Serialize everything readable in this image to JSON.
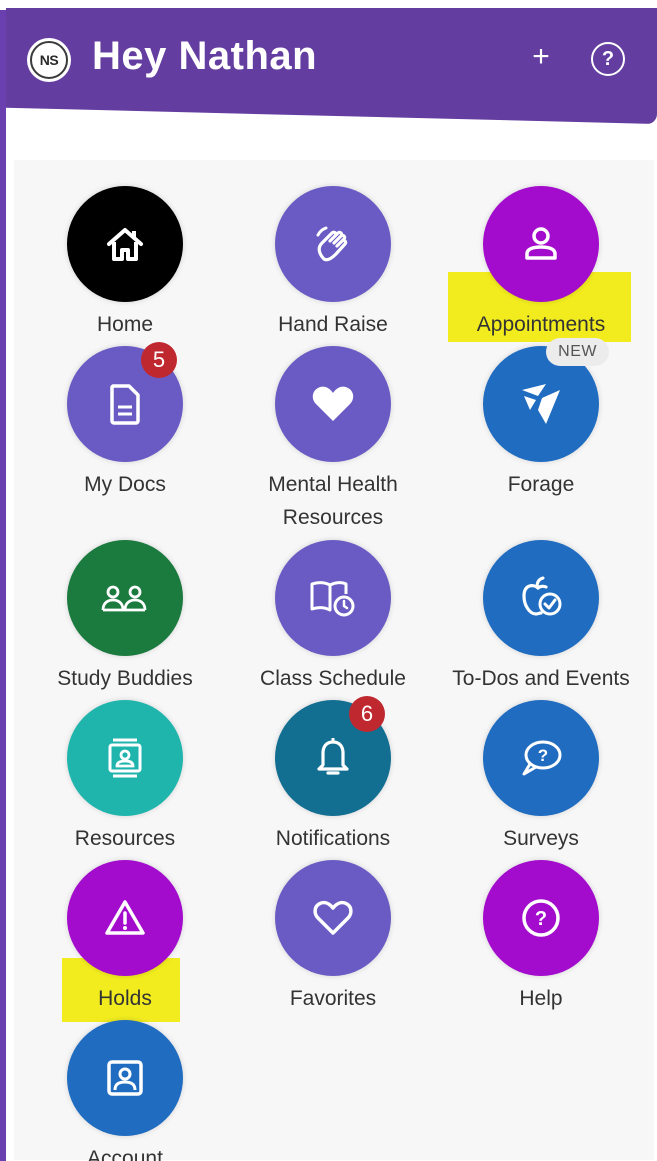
{
  "header": {
    "avatar_initials": "NS",
    "greeting": "Hey Nathan",
    "add_icon": "plus-icon",
    "help_icon": "question-circle-icon",
    "plus_glyph": "+",
    "help_glyph": "?",
    "background_color": "#643da0"
  },
  "tiles": [
    {
      "label": "Home",
      "icon": "home-icon",
      "color": "#000000"
    },
    {
      "label": "Hand Raise",
      "icon": "hand-raise-icon",
      "color": "#6a5bc4"
    },
    {
      "label": "Appointments",
      "icon": "person-icon",
      "color": "#a30ccc",
      "highlighted": true
    },
    {
      "label": "My Docs",
      "icon": "document-icon",
      "color": "#6a5bc4",
      "badge": "5"
    },
    {
      "label": "Mental Health Resources",
      "label_line1": "Mental Health",
      "label_line2": "Resources",
      "icon": "heart-icon",
      "color": "#6a5bc4"
    },
    {
      "label": "Forage",
      "icon": "forage-icon",
      "color": "#1f6cc0",
      "badge": "NEW"
    },
    {
      "label": "Study Buddies",
      "icon": "people-icon",
      "color": "#1b7a3e"
    },
    {
      "label": "Class Schedule",
      "icon": "book-clock-icon",
      "color": "#6a5bc4"
    },
    {
      "label": "To-Dos and Events",
      "icon": "apple-check-icon",
      "color": "#1f6cc0"
    },
    {
      "label": "Resources",
      "icon": "contact-card-icon",
      "color": "#1fb5ad"
    },
    {
      "label": "Notifications",
      "icon": "bell-icon",
      "color": "#126f92",
      "badge": "6"
    },
    {
      "label": "Surveys",
      "icon": "speech-question-icon",
      "color": "#1f6cc0"
    },
    {
      "label": "Holds",
      "icon": "warning-icon",
      "color": "#a30ccc",
      "highlighted": true
    },
    {
      "label": "Favorites",
      "icon": "heart-outline-icon",
      "color": "#6a5bc4"
    },
    {
      "label": "Help",
      "icon": "question-circle-icon",
      "color": "#a30ccc"
    },
    {
      "label": "Account",
      "icon": "account-icon",
      "color": "#1f6cc0"
    }
  ],
  "highlight_color": "#f2ec1f",
  "badge_color": "#c0282f"
}
